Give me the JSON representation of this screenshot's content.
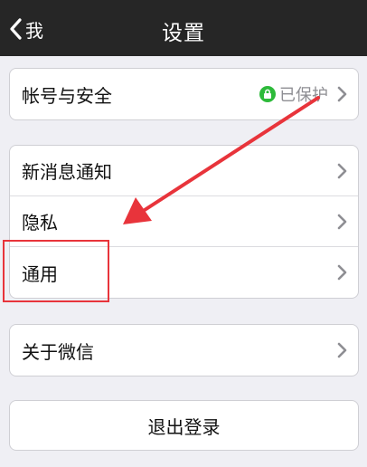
{
  "navbar": {
    "back_label": "我",
    "title": "设置"
  },
  "account_group": {
    "label": "帐号与安全",
    "status": "已保护",
    "status_icon": "lock-icon",
    "status_color": "#2dba3a"
  },
  "settings_group": {
    "items": [
      {
        "label": "新消息通知"
      },
      {
        "label": "隐私"
      },
      {
        "label": "通用"
      }
    ]
  },
  "about_group": {
    "label": "关于微信"
  },
  "logout": {
    "label": "退出登录"
  },
  "annotation": {
    "color": "#e8343b"
  }
}
